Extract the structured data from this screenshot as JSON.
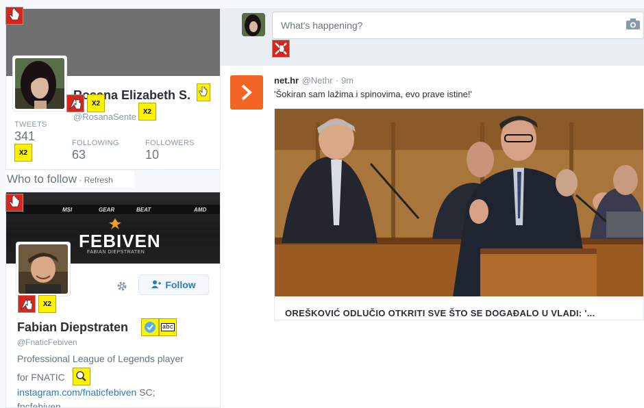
{
  "profile": {
    "name": "Rosana Elizabeth S.",
    "handle": "@RosanaSente",
    "stats": [
      {
        "label": "TWEETS",
        "value": "341"
      },
      {
        "label": "FOLLOWING",
        "value": "63"
      },
      {
        "label": "FOLLOWERS",
        "value": "10"
      }
    ]
  },
  "markers": {
    "double": "X2"
  },
  "who_to_follow": {
    "title": "Who to follow",
    "separator": " · ",
    "refresh": "Refresh"
  },
  "suggestion": {
    "banner_sponsors": [
      "MSI",
      "GEAR",
      "BEAT",
      "AMD"
    ],
    "banner_title": "FEBIVEN",
    "banner_subtitle": "FABIAN DIEPSTRATEN",
    "name": "Fabian Diepstraten",
    "handle": "@FnaticFebiven",
    "bio_line1": "Professional League of Legends player",
    "bio_line2": "for FNATIC",
    "link_text": "instagram.com/fnaticfebiven",
    "bio_after_link": " SC;",
    "bio_line4": "fncfebiven",
    "follow_label": "Follow",
    "verified_label": "abc"
  },
  "compose": {
    "placeholder": "What's happening?"
  },
  "tweet": {
    "author": "net.hr",
    "handle": "@Nethr",
    "time": "· 9m",
    "text": "'Šokiran sam lažima i spinovima, evo prave istine!'",
    "headline": "OREŠKOVIĆ ODLUČIO OTKRITI SVE ŠTO SE DOGAĐALO U VLADI: '..."
  },
  "colors": {
    "accent": "#2b7bb9",
    "marker_red": "#d9251c",
    "marker_yellow": "#fff200",
    "orange": "#f26522"
  }
}
